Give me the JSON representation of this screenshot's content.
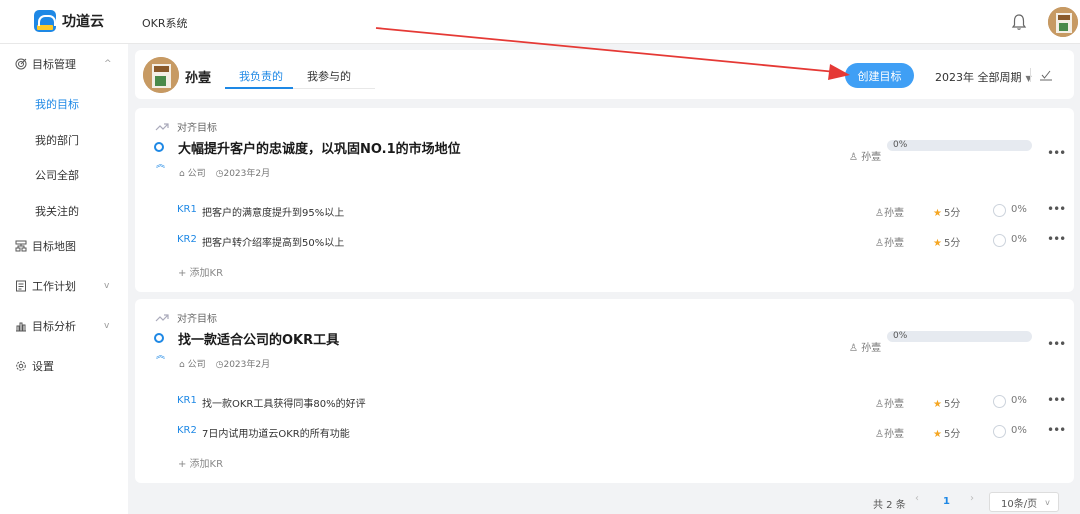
{
  "app": {
    "brand": "功道云",
    "title": "OKR系统"
  },
  "sidebar": {
    "items": [
      {
        "label": "目标管理",
        "icon": "target-icon",
        "expanded": true
      },
      {
        "label": "目标地图",
        "icon": "map-icon"
      },
      {
        "label": "工作计划",
        "icon": "document-icon"
      },
      {
        "label": "目标分析",
        "icon": "chart-icon"
      },
      {
        "label": "设置",
        "icon": "gear-icon"
      }
    ],
    "sub_items": [
      "我的目标",
      "我的部门",
      "公司全部",
      "我关注的"
    ],
    "active_sub": "我的目标"
  },
  "header": {
    "user_name": "孙壹",
    "tabs": [
      "我负责的",
      "我参与的"
    ],
    "create_button": "创建目标",
    "cycle": "2023年 全部周期"
  },
  "objectives": [
    {
      "align_label": "对齐目标",
      "title": "大幅提升客户的忠诚度，以巩固NO.1的市场地位",
      "scope": "公司",
      "period": "2023年2月",
      "owner": "孙壹",
      "progress": "0%",
      "krs": [
        {
          "no": "KR1",
          "text": "把客户的满意度提升到95%以上",
          "owner": "孙壹",
          "score": "5分",
          "progress": "0%"
        },
        {
          "no": "KR2",
          "text": "把客户转介绍率提高到50%以上",
          "owner": "孙壹",
          "score": "5分",
          "progress": "0%"
        }
      ],
      "add_kr": "+ 添加KR"
    },
    {
      "align_label": "对齐目标",
      "title": "找一款适合公司的OKR工具",
      "scope": "公司",
      "period": "2023年2月",
      "owner": "孙壹",
      "progress": "0%",
      "krs": [
        {
          "no": "KR1",
          "text": "找一款OKR工具获得同事80%的好评",
          "owner": "孙壹",
          "score": "5分",
          "progress": "0%"
        },
        {
          "no": "KR2",
          "text": "7日内试用功道云OKR的所有功能",
          "owner": "孙壹",
          "score": "5分",
          "progress": "0%"
        }
      ],
      "add_kr": "+ 添加KR"
    }
  ],
  "pagination": {
    "total": "共 2 条",
    "current": "1",
    "page_size": "10条/页"
  },
  "colors": {
    "accent": "#1e88e5",
    "button": "#3f9ff5",
    "annotation_arrow": "#e53935",
    "star": "#f5a623"
  }
}
